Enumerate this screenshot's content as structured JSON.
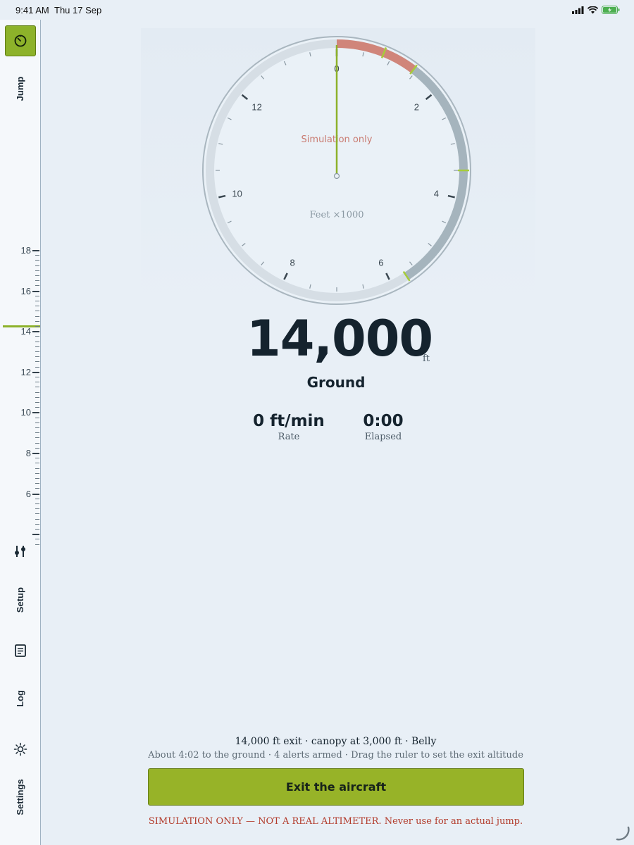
{
  "status_bar": {
    "time": "9:41 AM",
    "date": "Thu 17 Sep"
  },
  "rail": {
    "jump_label": "Jump",
    "setup_label": "Setup",
    "log_label": "Log",
    "settings_label": "Settings",
    "icons": [
      "gauge-icon",
      "sliders-icon",
      "log-icon",
      "sun-icon"
    ]
  },
  "ruler": {
    "labels": [
      "18",
      "16",
      "14",
      "12",
      "10",
      "8",
      "6"
    ],
    "current": 14
  },
  "gauge": {
    "dial_labels": [
      "0",
      "2",
      "4",
      "6",
      "8",
      "10",
      "12"
    ],
    "simulation_text": "Simulation only",
    "unit_text": "Feet ×1000",
    "needle_value": 0,
    "colors": {
      "danger": "#d0857a",
      "canopy": "#a5b4bd",
      "needle": "#8db22a"
    }
  },
  "readout": {
    "altitude": "14,000",
    "unit": "ft",
    "phase": "Ground",
    "rate_value": "0 ft/min",
    "rate_label": "Rate",
    "elapsed_value": "0:00",
    "elapsed_label": "Elapsed"
  },
  "footer": {
    "summary": "14,000 ft exit · canopy at 3,000 ft · Belly",
    "subsummary": "About 4:02 to the ground · 4 alerts armed · Drag the ruler to set the exit altitude",
    "exit_button": "Exit the aircraft",
    "warning": "SIMULATION ONLY — NOT A REAL ALTIMETER. Never use for an actual jump."
  }
}
